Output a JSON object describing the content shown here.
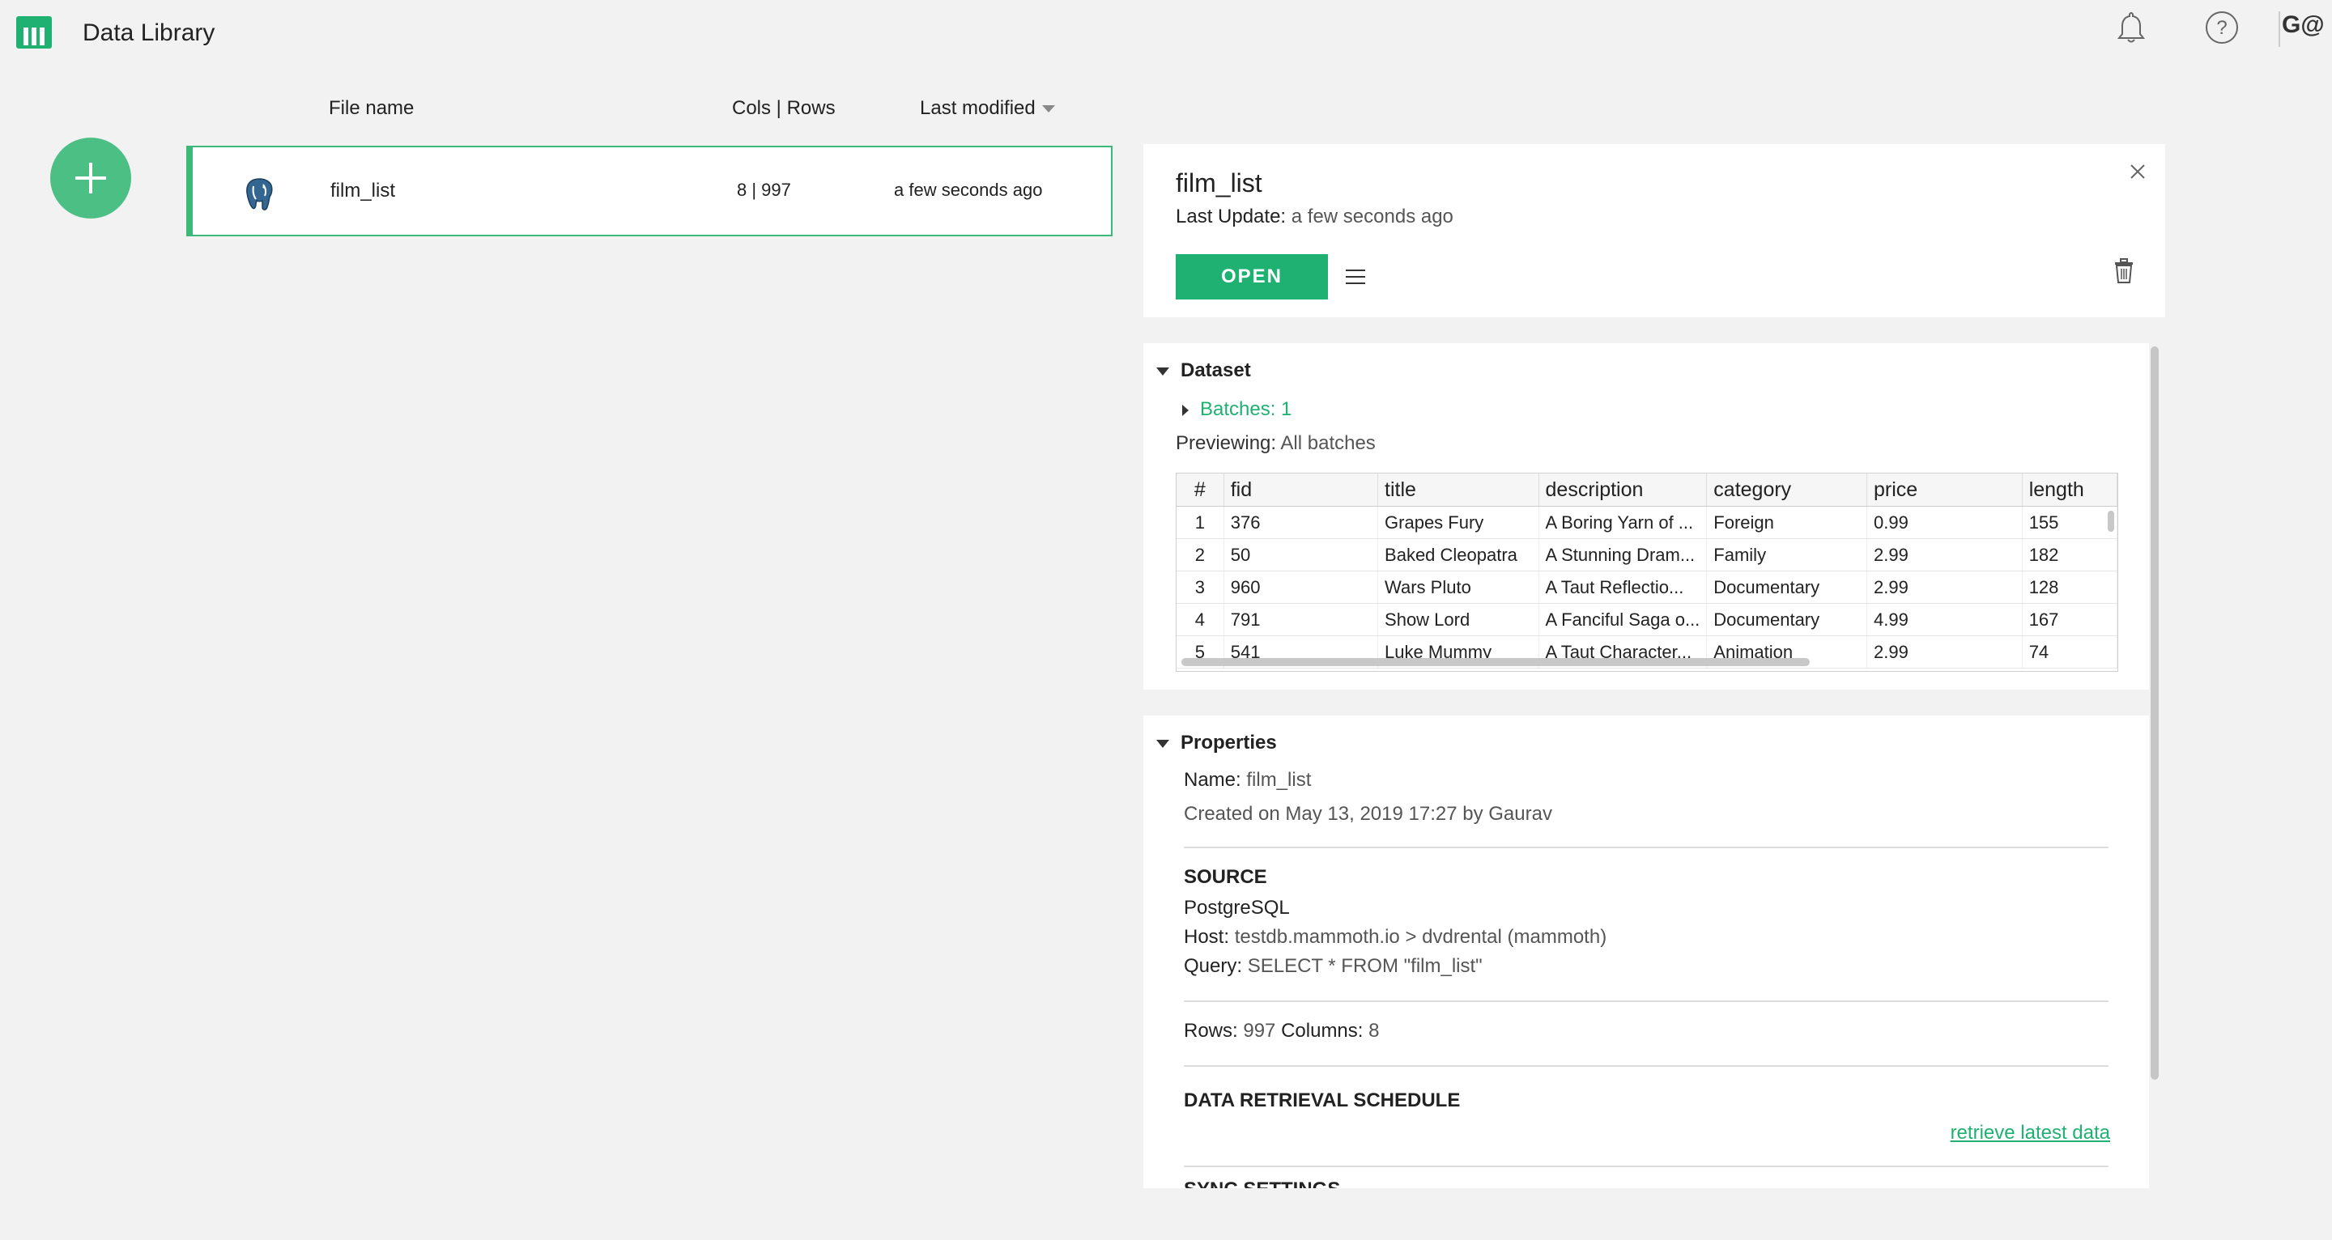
{
  "app": {
    "title": "Data Library",
    "user_initials": "G@"
  },
  "icons": {
    "logo": "mammoth-logo-icon",
    "notifications": "bell-icon",
    "help": "help-icon",
    "add": "plus-icon",
    "postgres": "postgresql-icon",
    "menu": "menu-icon",
    "close": "close-icon",
    "delete": "trash-icon"
  },
  "colors": {
    "accent": "#1fb171",
    "fab": "#4cbf85",
    "selected_border": "#3cb878"
  },
  "file_list": {
    "headers": {
      "name": "File name",
      "cols_rows": "Cols | Rows",
      "modified": "Last modified"
    },
    "files": [
      {
        "name": "film_list",
        "cols_rows": "8 | 997",
        "modified": "a few seconds ago"
      }
    ]
  },
  "detail": {
    "title": "film_list",
    "last_update_label": "Last Update:",
    "last_update_value": "a few seconds ago",
    "open_label": "OPEN",
    "dataset": {
      "heading": "Dataset",
      "batches": "Batches: 1",
      "previewing_label": "Previewing:",
      "previewing_value": "All batches",
      "columns": [
        "#",
        "fid",
        "title",
        "description",
        "category",
        "price",
        "length"
      ],
      "rows": [
        [
          "1",
          "376",
          "Grapes Fury",
          "A Boring Yarn of ...",
          "Foreign",
          "0.99",
          "155"
        ],
        [
          "2",
          "50",
          "Baked Cleopatra",
          "A Stunning Dram...",
          "Family",
          "2.99",
          "182"
        ],
        [
          "3",
          "960",
          "Wars Pluto",
          "A Taut Reflectio...",
          "Documentary",
          "2.99",
          "128"
        ],
        [
          "4",
          "791",
          "Show Lord",
          "A Fanciful Saga o...",
          "Documentary",
          "4.99",
          "167"
        ],
        [
          "5",
          "541",
          "Luke Mummy",
          "A Taut Character...",
          "Animation",
          "2.99",
          "74"
        ]
      ]
    },
    "properties": {
      "heading": "Properties",
      "name_label": "Name:",
      "name_value": "film_list",
      "created": "Created on May 13, 2019 17:27 by Gaurav",
      "source_heading": "SOURCE",
      "source_type": "PostgreSQL",
      "host_label": "Host:",
      "host_value": "testdb.mammoth.io > dvdrental (mammoth)",
      "query_label": "Query:",
      "query_value": "SELECT * FROM \"film_list\"",
      "rows_label": "Rows:",
      "rows_value": "997",
      "columns_label": "Columns:",
      "columns_value": "8",
      "schedule_heading": "DATA RETRIEVAL SCHEDULE",
      "retrieve_link": "retrieve latest data",
      "sync_heading": "SYNC SETTINGS"
    }
  }
}
